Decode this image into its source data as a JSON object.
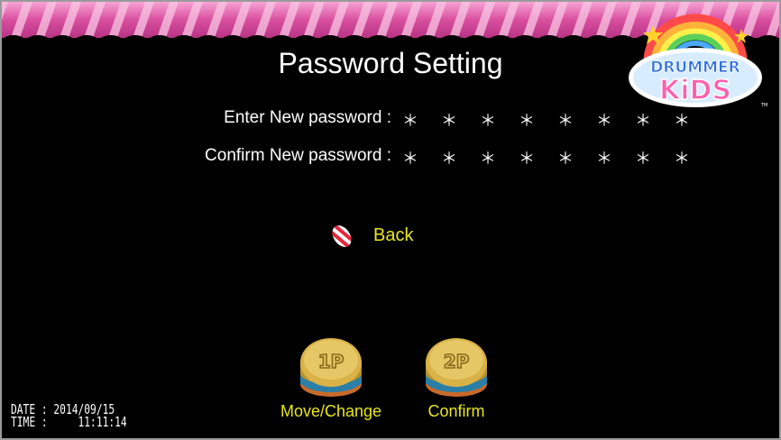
{
  "screen": {
    "title": "Password Setting",
    "logo": {
      "line1": "DRUMMER",
      "line2": "KiDS",
      "tm": "TM"
    }
  },
  "form": {
    "new_password": {
      "label": "Enter New password :",
      "value": "＊ ＊ ＊ ＊ ＊ ＊ ＊ ＊"
    },
    "confirm_password": {
      "label": "Confirm New password :",
      "value": "＊ ＊ ＊ ＊ ＊ ＊ ＊ ＊"
    }
  },
  "menu": {
    "back_label": "Back",
    "cursor_icon": "candy-icon"
  },
  "controls": {
    "p1": {
      "badge": "1P",
      "caption": "Move/Change"
    },
    "p2": {
      "badge": "2P",
      "caption": "Confirm"
    }
  },
  "status": {
    "date_line": "DATE : 2014/09/15",
    "time_line": "TIME :     11:11:14"
  },
  "colors": {
    "accent": "#e9e61a",
    "banner": "#e45aa8",
    "background": "#000000"
  }
}
